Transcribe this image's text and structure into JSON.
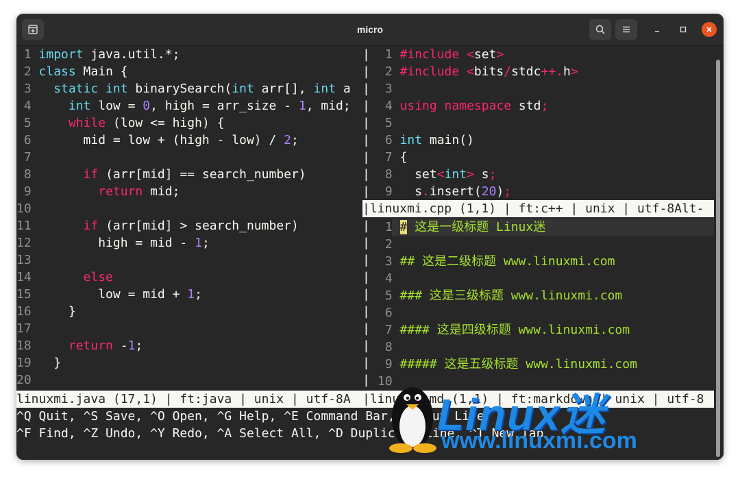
{
  "window": {
    "title": "micro"
  },
  "left_pane": {
    "lines": [
      [
        "1",
        "import java.util.*;"
      ],
      [
        "2",
        "class Main {"
      ],
      [
        "3",
        "  static int binarySearch(int arr[], int a"
      ],
      [
        "4",
        "    int low = 0, high = arr_size - 1, mid;"
      ],
      [
        "5",
        "    while (low <= high) {"
      ],
      [
        "6",
        "      mid = low + (high - low) / 2;"
      ],
      [
        "7",
        ""
      ],
      [
        "8",
        "      if (arr[mid] == search_number)"
      ],
      [
        "9",
        "        return mid;"
      ],
      [
        "10",
        ""
      ],
      [
        "11",
        "      if (arr[mid] > search_number)"
      ],
      [
        "12",
        "        high = mid - 1;"
      ],
      [
        "13",
        ""
      ],
      [
        "14",
        "      else"
      ],
      [
        "15",
        "        low = mid + 1;"
      ],
      [
        "16",
        "    }"
      ],
      [
        "17",
        ""
      ],
      [
        "18",
        "    return -1;"
      ],
      [
        "19",
        "  }"
      ],
      [
        "20",
        ""
      ]
    ],
    "status": "linuxmi.java (17,1) | ft:java | unix | utf-8A"
  },
  "top_right_pane": {
    "lines": [
      [
        "1",
        "#include <set>"
      ],
      [
        "2",
        "#include <bits/stdc++.h>"
      ],
      [
        "3",
        ""
      ],
      [
        "4",
        "using namespace std;"
      ],
      [
        "5",
        ""
      ],
      [
        "6",
        "int main()"
      ],
      [
        "7",
        "{"
      ],
      [
        "8",
        "  set<int> s;"
      ],
      [
        "9",
        "  s.insert(20);"
      ]
    ],
    "status": "linuxmi.cpp (1,1) | ft:c++ | unix | utf-8Alt-"
  },
  "bottom_right_pane": {
    "lines": [
      [
        "1",
        "# 这是一级标题 Linux迷"
      ],
      [
        "2",
        ""
      ],
      [
        "3",
        "## 这是二级标题 www.linuxmi.com"
      ],
      [
        "4",
        ""
      ],
      [
        "5",
        "### 这是三级标题 www.linuxmi.com"
      ],
      [
        "6",
        ""
      ],
      [
        "7",
        "#### 这是四级标题 www.linuxmi.com"
      ],
      [
        "8",
        ""
      ],
      [
        "9",
        "##### 这是五级标题 www.linuxmi.com"
      ],
      [
        "10",
        ""
      ]
    ],
    "status": "linuxmi.md (1,1) | ft:markdown | unix | utf-8"
  },
  "help": {
    "line1": "^Q Quit, ^S Save, ^O Open, ^G Help, ^E Command Bar, ^K Cut Line",
    "line2": "^F Find, ^Z Undo, ^Y Redo, ^A Select All, ^D Duplicate Line, ^T New Tab"
  },
  "watermark": {
    "brand": "Linux迷",
    "url": "www.linuxmi.com"
  },
  "colors": {
    "close": "#e95420",
    "bg": "#272727",
    "keyword": "#66d9ef",
    "keyword2": "#f92672",
    "number": "#ae81ff",
    "heading": "#a6e22e"
  },
  "icons": [
    "new-window-icon",
    "search-icon",
    "hamburger-menu-icon",
    "minimize-icon",
    "maximize-icon",
    "close-icon"
  ]
}
